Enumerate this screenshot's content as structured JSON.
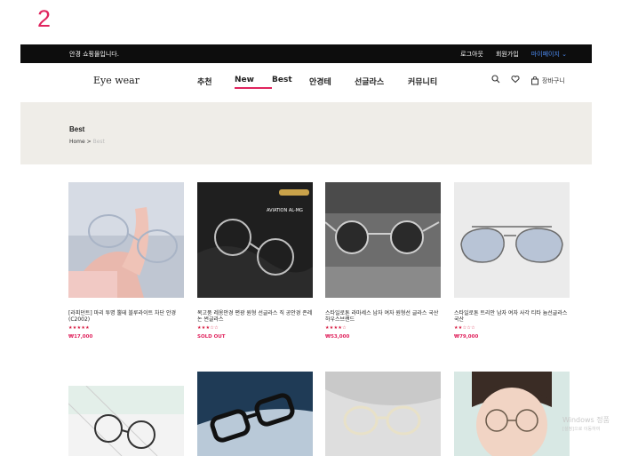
{
  "page_number": "2",
  "topbar": {
    "notice": "안경 쇼핑몰입니다.",
    "links": [
      "로그아웃",
      "회원가입"
    ],
    "mypage": "마이페이지 ⌄"
  },
  "nav": {
    "brand": "Eye wear",
    "menu": [
      "추천",
      "New",
      "Best",
      "안경테",
      "선글라스",
      "커뮤니티"
    ],
    "active": "New",
    "cart_label": "장바구니"
  },
  "hero": {
    "title": "Best",
    "breadcrumb": {
      "home": "Home",
      "sep": ">",
      "current": "Best"
    }
  },
  "products": [
    {
      "name": "[라피던트] 마리 투명 뿔테 블루라이트 차단 안경 (C2002)",
      "stars": "★★★★★",
      "price": "₩17,000"
    },
    {
      "name": "복고풍 레옹안경 편광 원형 선글라스 직 공안경 존레논 썬글라스",
      "stars": "★★★☆☆",
      "price": "SOLD OUT"
    },
    {
      "name": "스타일로톤 라마세스 남자 여자 원형선 글라스 국산 하우스브랜드",
      "stars": "★★★★☆",
      "price": "₩53,000"
    },
    {
      "name": "스타일로톤 트리안 남자 여자 사각 티타 늄선글라스 국산",
      "stars": "★★☆☆☆",
      "price": "₩79,000"
    }
  ],
  "watermark": {
    "line1": "Windows 정품",
    "line2": "[설정]으로 이동하여"
  },
  "colors": {
    "accent": "#e0245e",
    "topbar": "#0d0d0d",
    "hero_bg": "#efede8",
    "mypage_link": "#4e8ef7"
  }
}
